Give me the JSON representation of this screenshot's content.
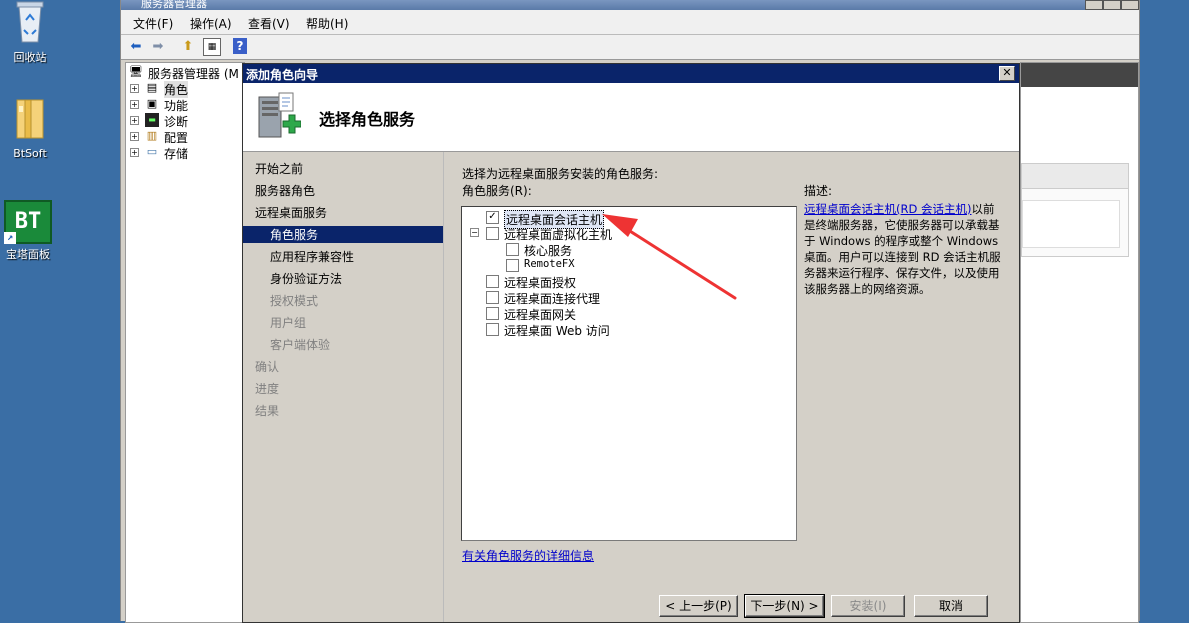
{
  "desktop": {
    "icons": [
      {
        "label": "回收站",
        "icon": "recycle-bin-icon"
      },
      {
        "label": "BtSoft",
        "icon": "folder-icon"
      },
      {
        "label": "宝塔面板",
        "icon": "bt-panel-icon",
        "badge": "BT"
      }
    ]
  },
  "mmc": {
    "title": "服务器管理器",
    "menu": [
      "文件(F)",
      "操作(A)",
      "查看(V)",
      "帮助(H)"
    ],
    "tree": {
      "root": "服务器管理器 (M",
      "items": [
        "角色",
        "功能",
        "诊断",
        "配置",
        "存储"
      ],
      "expander": "+"
    }
  },
  "dialog": {
    "title": "添加角色向导",
    "close": "✕",
    "header_title": "选择角色服务",
    "nav": [
      {
        "label": "开始之前",
        "sub": false,
        "state": "normal"
      },
      {
        "label": "服务器角色",
        "sub": false,
        "state": "normal"
      },
      {
        "label": "远程桌面服务",
        "sub": false,
        "state": "normal"
      },
      {
        "label": "角色服务",
        "sub": true,
        "state": "selected"
      },
      {
        "label": "应用程序兼容性",
        "sub": true,
        "state": "normal"
      },
      {
        "label": "身份验证方法",
        "sub": true,
        "state": "normal"
      },
      {
        "label": "授权模式",
        "sub": true,
        "state": "dim"
      },
      {
        "label": "用户组",
        "sub": true,
        "state": "dim"
      },
      {
        "label": "客户端体验",
        "sub": true,
        "state": "dim"
      },
      {
        "label": "确认",
        "sub": false,
        "state": "dim"
      },
      {
        "label": "进度",
        "sub": false,
        "state": "dim"
      },
      {
        "label": "结果",
        "sub": false,
        "state": "dim"
      }
    ],
    "instruction": "选择为远程桌面服务安装的角色服务:",
    "list_label": "角色服务(R):",
    "desc_label": "描述:",
    "role_services": [
      {
        "label": "远程桌面会话主机",
        "checked": true,
        "level": 0,
        "expander": "",
        "highlight": true
      },
      {
        "label": "远程桌面虚拟化主机",
        "checked": false,
        "level": 0,
        "expander": "−"
      },
      {
        "label": "核心服务",
        "checked": false,
        "level": 1,
        "expander": ""
      },
      {
        "label": "RemoteFX",
        "checked": false,
        "level": 1,
        "expander": ""
      },
      {
        "label": "远程桌面授权",
        "checked": false,
        "level": 0,
        "expander": ""
      },
      {
        "label": "远程桌面连接代理",
        "checked": false,
        "level": 0,
        "expander": ""
      },
      {
        "label": "远程桌面网关",
        "checked": false,
        "level": 0,
        "expander": ""
      },
      {
        "label": "远程桌面 Web 访问",
        "checked": false,
        "level": 0,
        "expander": ""
      }
    ],
    "description_link": "远程桌面会话主机(RD 会话主机)",
    "description_rest": "以前是终端服务器，它使服务器可以承载基于 Windows 的程序或整个 Windows 桌面。用户可以连接到 RD 会话主机服务器来运行程序、保存文件，以及使用该服务器上的网络资源。",
    "more_info_link": "有关角色服务的详细信息",
    "buttons": {
      "back": "< 上一步(P)",
      "next": "下一步(N) >",
      "install": "安装(I)",
      "cancel": "取消"
    }
  },
  "colors": {
    "desktop": "#3a6ea5",
    "titlebar": "#0a246a",
    "annotation_arrow": "#ee3333",
    "link": "#0000cc"
  }
}
